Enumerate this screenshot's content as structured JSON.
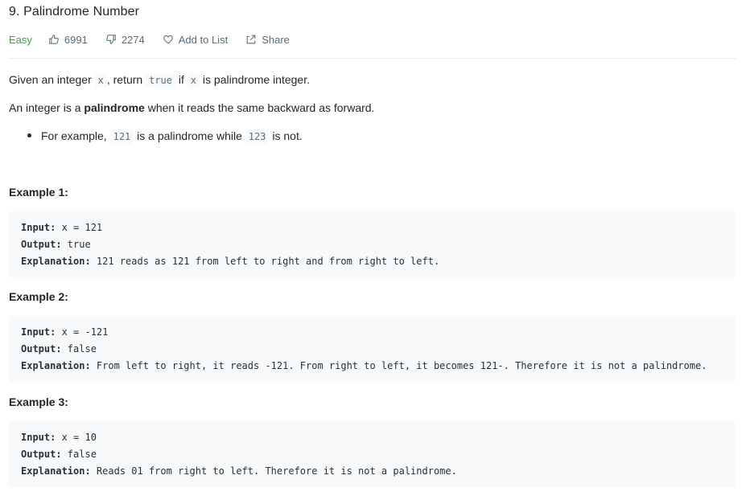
{
  "problem": {
    "title": "9. Palindrome Number",
    "difficulty": "Easy",
    "likes": "6991",
    "dislikes": "2274",
    "add_to_list": "Add to List",
    "share": "Share"
  },
  "description": {
    "p1": {
      "a": "Given an integer ",
      "c1": "x",
      "b": ", return ",
      "c2": "true",
      "c": " if ",
      "c3": "x",
      "d": " is palindrome integer."
    },
    "p2": {
      "a": "An integer is a ",
      "bold": "palindrome",
      "b": " when it reads the same backward as forward."
    },
    "bullet": {
      "a": "For example, ",
      "c1": "121",
      "b": " is a palindrome while ",
      "c2": "123",
      "c": " is not."
    }
  },
  "examples": [
    {
      "heading": "Example 1:",
      "input_label": "Input:",
      "input": " x = 121",
      "output_label": "Output:",
      "output": " true",
      "explanation_label": "Explanation:",
      "explanation": " 121 reads as 121 from left to right and from right to left."
    },
    {
      "heading": "Example 2:",
      "input_label": "Input:",
      "input": " x = -121",
      "output_label": "Output:",
      "output": " false",
      "explanation_label": "Explanation:",
      "explanation": " From left to right, it reads -121. From right to left, it becomes 121-. Therefore it is not a palindrome."
    },
    {
      "heading": "Example 3:",
      "input_label": "Input:",
      "input": " x = 10",
      "output_label": "Output:",
      "output": " false",
      "explanation_label": "Explanation:",
      "explanation": " Reads 01 from right to left. Therefore it is not a palindrome."
    }
  ],
  "icons": {
    "like": "thumbs-up-icon",
    "dislike": "thumbs-down-icon",
    "add": "heart-icon",
    "share": "share-icon"
  },
  "colors": {
    "easy": "#43a047",
    "meta": "#546e7a",
    "code_bg": "#f7f9fa"
  }
}
